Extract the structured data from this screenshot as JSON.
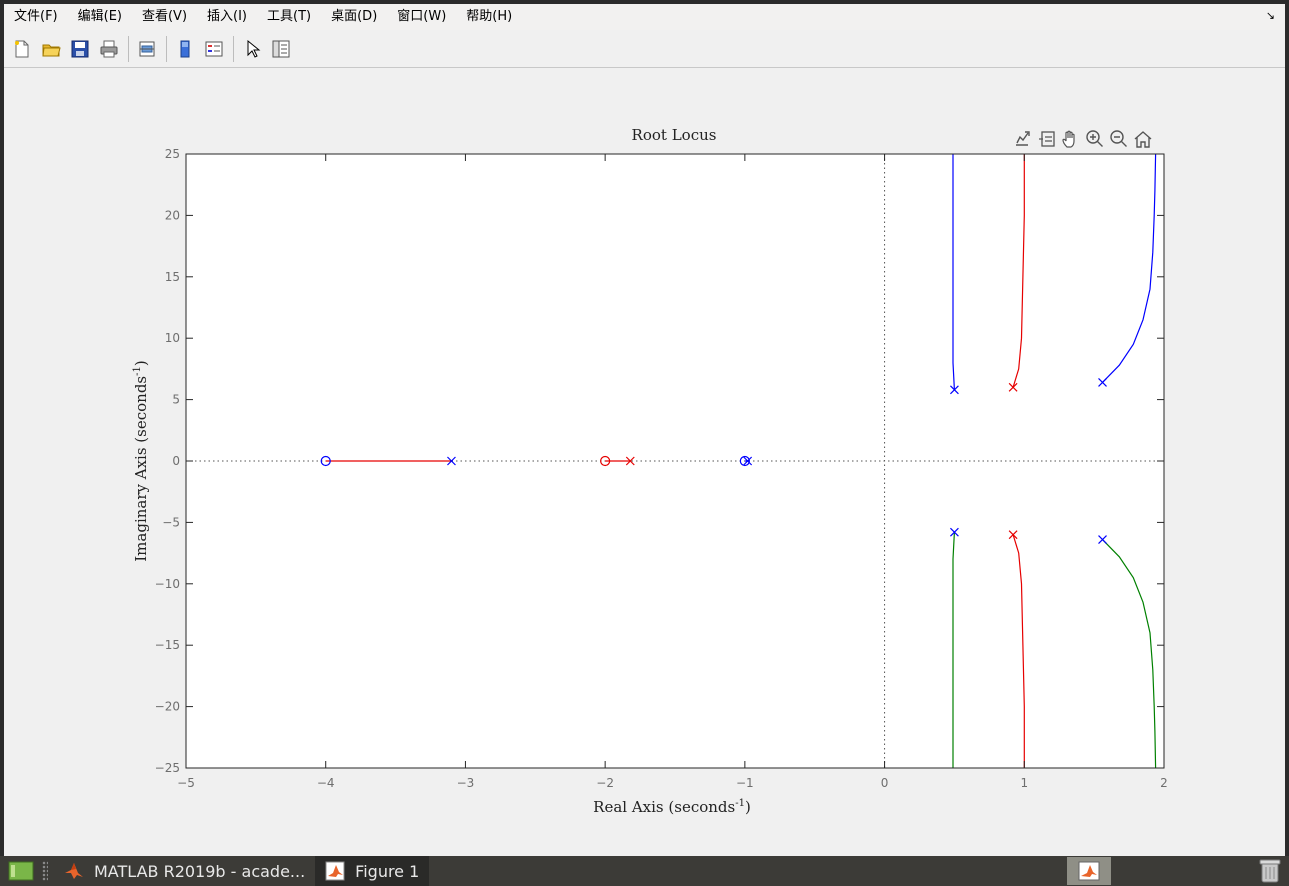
{
  "menubar": {
    "items": [
      "文件(F)",
      "编辑(E)",
      "查看(V)",
      "插入(I)",
      "工具(T)",
      "桌面(D)",
      "窗口(W)",
      "帮助(H)"
    ],
    "collapse_glyph": "↘"
  },
  "toolbar": {
    "icons": [
      "new-figure-icon",
      "open-file-icon",
      "save-icon",
      "print-icon",
      "link-plot-icon",
      "colorbar-icon",
      "legend-icon",
      "select-arrow-icon",
      "property-inspector-icon"
    ]
  },
  "axes_toolbar": {
    "icons": [
      "export-icon",
      "brush-data-icon",
      "pan-hand-icon",
      "zoom-in-icon",
      "zoom-out-icon",
      "home-restore-icon"
    ]
  },
  "chart_data": {
    "type": "line",
    "title": "Root Locus",
    "xlabel_main": "Real Axis (seconds",
    "xlabel_sup": "-1",
    "xlabel_end": ")",
    "ylabel_main": "Imaginary Axis (seconds",
    "ylabel_sup": "-1",
    "ylabel_end": ")",
    "xlim": [
      -5,
      2
    ],
    "ylim": [
      -25,
      25
    ],
    "xticks": [
      -5,
      -4,
      -3,
      -2,
      -1,
      0,
      1,
      2
    ],
    "yticks": [
      -25,
      -20,
      -15,
      -10,
      -5,
      0,
      5,
      10,
      15,
      20,
      25
    ],
    "grid": false,
    "reference_lines": [
      {
        "axis": "x",
        "value": 0,
        "style": "dotted"
      },
      {
        "axis": "y",
        "value": 0,
        "style": "dotted"
      }
    ],
    "colors": {
      "blue": "#0000ff",
      "red": "#e60000",
      "green": "#008000"
    },
    "series": [
      {
        "color": "#0000ff",
        "points": [
          [
            0.5,
            5.8
          ],
          [
            0.49,
            8
          ],
          [
            0.49,
            10.5
          ],
          [
            0.49,
            15
          ],
          [
            0.49,
            20
          ],
          [
            0.49,
            25
          ]
        ]
      },
      {
        "color": "#e60000",
        "points": [
          [
            0.92,
            6.0
          ],
          [
            0.96,
            7.5
          ],
          [
            0.98,
            10
          ],
          [
            0.99,
            15
          ],
          [
            1.0,
            20
          ],
          [
            1.0,
            25
          ]
        ]
      },
      {
        "color": "#0000ff",
        "points": [
          [
            1.56,
            6.4
          ],
          [
            1.68,
            7.8
          ],
          [
            1.78,
            9.5
          ],
          [
            1.85,
            11.5
          ],
          [
            1.9,
            14
          ],
          [
            1.92,
            17
          ],
          [
            1.93,
            20
          ],
          [
            1.935,
            22
          ],
          [
            1.94,
            25
          ]
        ]
      },
      {
        "color": "#008000",
        "points": [
          [
            0.5,
            -5.8
          ],
          [
            0.49,
            -8
          ],
          [
            0.49,
            -10.5
          ],
          [
            0.49,
            -15
          ],
          [
            0.49,
            -20
          ],
          [
            0.49,
            -25
          ]
        ]
      },
      {
        "color": "#e60000",
        "points": [
          [
            0.92,
            -6.0
          ],
          [
            0.96,
            -7.5
          ],
          [
            0.98,
            -10
          ],
          [
            0.99,
            -15
          ],
          [
            1.0,
            -20
          ],
          [
            1.0,
            -25
          ]
        ]
      },
      {
        "color": "#008000",
        "points": [
          [
            1.56,
            -6.4
          ],
          [
            1.68,
            -7.8
          ],
          [
            1.78,
            -9.5
          ],
          [
            1.85,
            -11.5
          ],
          [
            1.9,
            -14
          ],
          [
            1.92,
            -17
          ],
          [
            1.93,
            -20
          ],
          [
            1.935,
            -22
          ],
          [
            1.94,
            -25
          ]
        ]
      },
      {
        "color": "#e60000",
        "points": [
          [
            -3.1,
            0
          ],
          [
            -4.0,
            0
          ]
        ]
      },
      {
        "color": "#e60000",
        "points": [
          [
            -1.82,
            0
          ],
          [
            -2.0,
            0
          ]
        ]
      },
      {
        "color": "#0000ff",
        "points": [
          [
            -0.98,
            0
          ],
          [
            -1.0,
            0
          ]
        ]
      }
    ],
    "poles": [
      {
        "x": 0.5,
        "y": 5.8,
        "color": "#0000ff"
      },
      {
        "x": 0.92,
        "y": 6.0,
        "color": "#e60000"
      },
      {
        "x": 1.56,
        "y": 6.4,
        "color": "#0000ff"
      },
      {
        "x": 0.5,
        "y": -5.8,
        "color": "#0000ff"
      },
      {
        "x": 0.92,
        "y": -6.0,
        "color": "#e60000"
      },
      {
        "x": 1.56,
        "y": -6.4,
        "color": "#0000ff"
      },
      {
        "x": -3.1,
        "y": 0,
        "color": "#0000ff"
      },
      {
        "x": -1.82,
        "y": 0,
        "color": "#e60000"
      },
      {
        "x": -0.98,
        "y": 0,
        "color": "#0000ff"
      }
    ],
    "zeros": [
      {
        "x": -4.0,
        "y": 0,
        "color": "#0000ff"
      },
      {
        "x": -2.0,
        "y": 0,
        "color": "#e60000"
      },
      {
        "x": -1.0,
        "y": 0,
        "color": "#0000ff"
      }
    ]
  },
  "taskbar": {
    "entries": [
      {
        "label": "MATLAB R2019b - acade...",
        "icon": "matlab-icon",
        "active": false
      },
      {
        "label": "Figure 1",
        "icon": "figure-icon",
        "active": true
      }
    ]
  }
}
